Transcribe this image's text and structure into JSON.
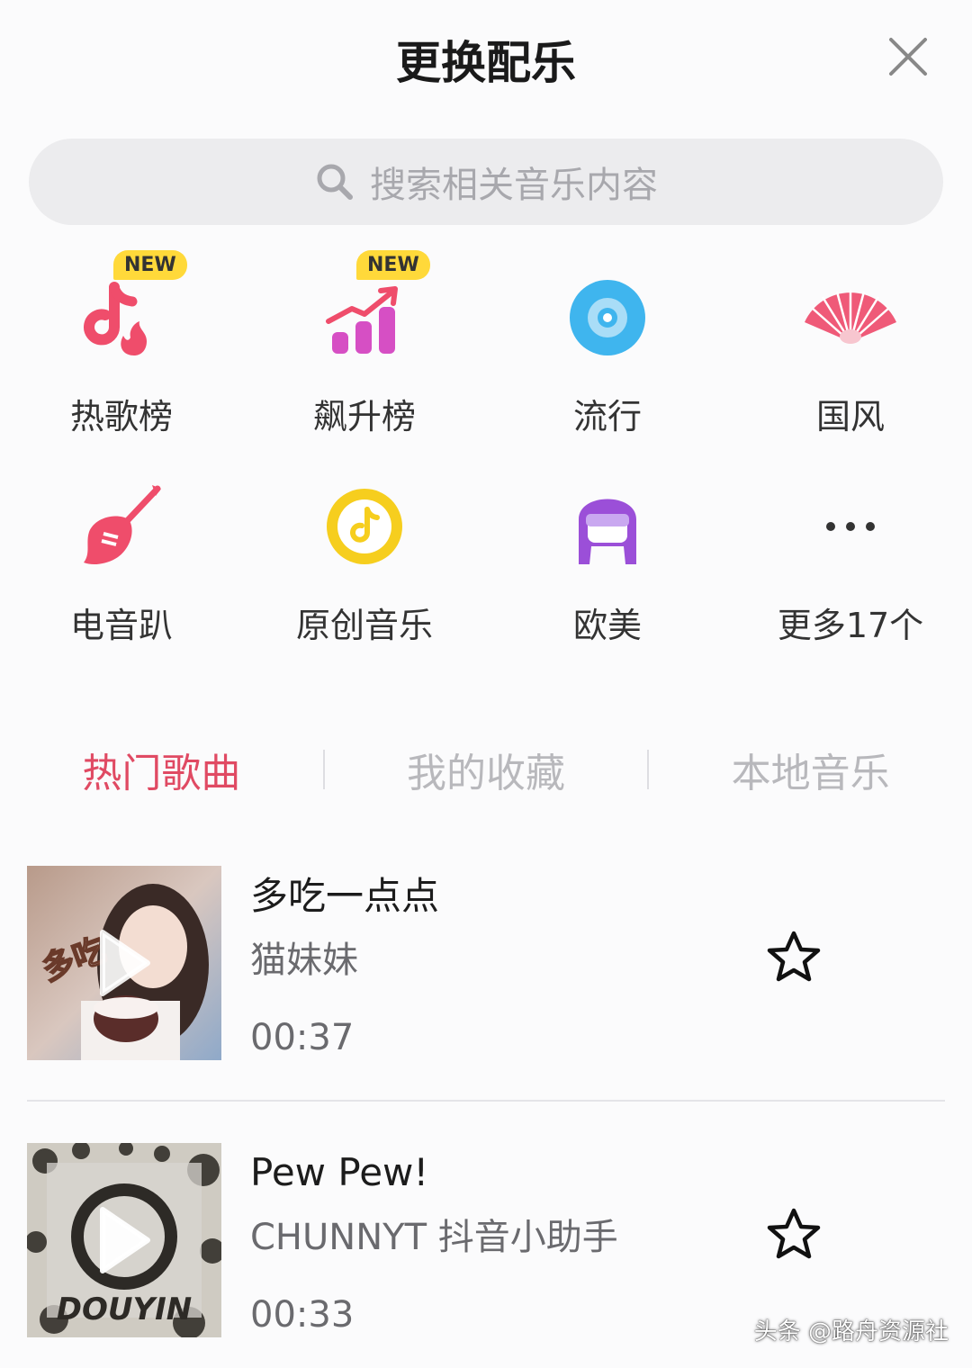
{
  "header": {
    "title": "更换配乐",
    "close_icon": "close-icon"
  },
  "search": {
    "placeholder": "搜索相关音乐内容",
    "icon": "search-icon"
  },
  "categories": [
    {
      "label": "热歌榜",
      "badge": "NEW",
      "icon": "hot-chart-icon"
    },
    {
      "label": "飙升榜",
      "badge": "NEW",
      "icon": "rising-chart-icon"
    },
    {
      "label": "流行",
      "icon": "vinyl-disc-icon"
    },
    {
      "label": "国风",
      "icon": "folding-fan-icon"
    },
    {
      "label": "电音趴",
      "icon": "guitar-icon"
    },
    {
      "label": "原创音乐",
      "icon": "music-note-circle-icon"
    },
    {
      "label": "欧美",
      "icon": "sunglasses-avatar-icon"
    },
    {
      "label": "更多17个",
      "icon": "more-dots-icon"
    }
  ],
  "tabs": [
    {
      "label": "热门歌曲",
      "active": true
    },
    {
      "label": "我的收藏",
      "active": false
    },
    {
      "label": "本地音乐",
      "active": false
    }
  ],
  "songs": [
    {
      "title": "多吃一点点",
      "artist": "猫妹妹",
      "duration": "00:37",
      "cover_text": "多吃一点点"
    },
    {
      "title": "Pew Pew!",
      "artist": "CHUNNYT 抖音小助手",
      "duration": "00:33",
      "cover_text": "DOUYIN"
    }
  ],
  "watermark": "头条 @路舟资源社",
  "colors": {
    "accent": "#e04a63",
    "badge": "#ffd93a",
    "tab_inactive": "#b8b8bc"
  }
}
